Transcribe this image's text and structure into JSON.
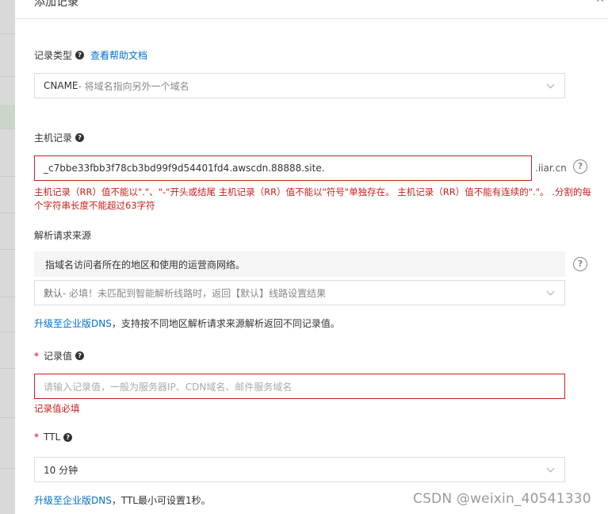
{
  "dialog": {
    "title": "添加记录",
    "close_icon": "close-icon"
  },
  "record_type": {
    "label": "记录类型",
    "help_link": "查看帮助文档",
    "selected_strong": "CNAME",
    "selected_desc": "- 将域名指向另外一个域名"
  },
  "host": {
    "label": "主机记录",
    "value": "_c7bbe33fbb3f78cb3bd99f9d54401fd4.awscdn.88888.site.",
    "suffix": ".iiar.cn",
    "error_line1": "主机记录（RR）值不能以\".\"、\"-\"开头或结尾 主机记录（RR）值不能以\"符号\"单独存在。 主机记录（RR）值不能有连续的\".\"。 .分割的每",
    "error_line2": "个字符串长度不能超过63字符"
  },
  "resolve_source": {
    "label": "解析请求来源",
    "info": "指域名访问者所在的地区和使用的运营商网络。",
    "selected_strong": "默认",
    "selected_desc": " - 必填！未匹配到智能解析线路时，返回【默认】线路设置结果",
    "upgrade_link": "升级至企业版DNS",
    "upgrade_text": "，支持按不同地区解析请求来源解析返回不同记录值。"
  },
  "record_value": {
    "required_mark": "*",
    "label": "记录值",
    "placeholder": "请输入记录值，一般为服务器IP、CDN域名、邮件服务域名",
    "error": "记录值必填"
  },
  "ttl": {
    "required_mark": "*",
    "label": "TTL",
    "selected": "10 分钟",
    "upgrade_link": "升级至企业版DNS",
    "upgrade_text": "，TTL最小可设置1秒。"
  },
  "watermark": "CSDN @weixin_40541330",
  "colors": {
    "link": "#0070cc",
    "error": "#c8201b",
    "required": "#d9001b"
  }
}
